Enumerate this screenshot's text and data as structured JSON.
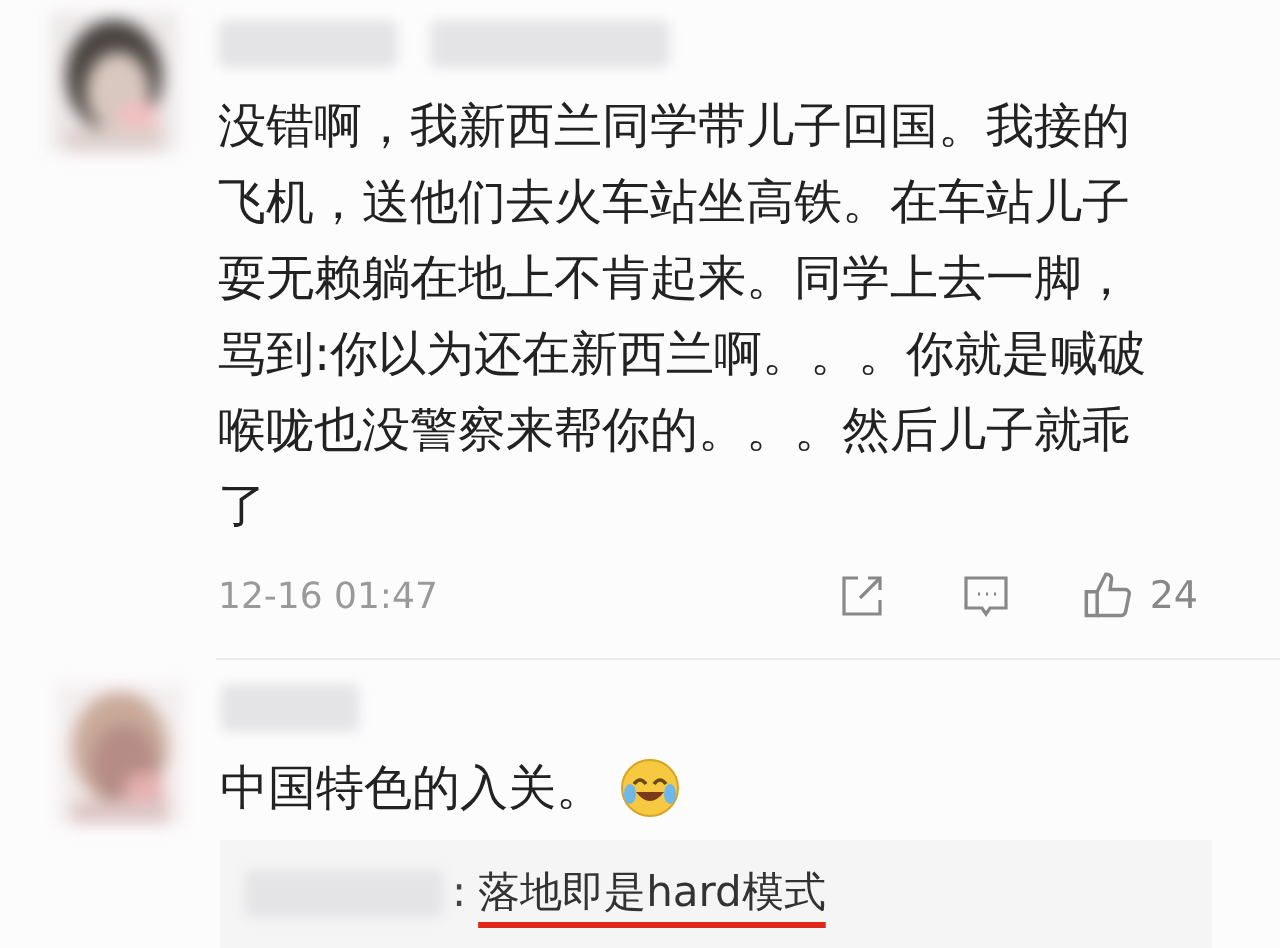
{
  "comments": [
    {
      "text": "没错啊，我新西兰同学带儿子回国。我接的飞机，送他们去火车站坐高铁。在车站儿子耍无赖躺在地上不肯起来。同学上去一脚，骂到:你以为还在新西兰啊。。。你就是喊破喉咙也没警察来帮你的。。。然后儿子就乖了",
      "time": "12-16 01:47",
      "likes": "24",
      "emoji": false
    },
    {
      "text": "中国特色的入关。",
      "emoji": true,
      "reply": {
        "separator": ":",
        "text": "落地即是hard模式",
        "underlined": true
      }
    }
  ]
}
